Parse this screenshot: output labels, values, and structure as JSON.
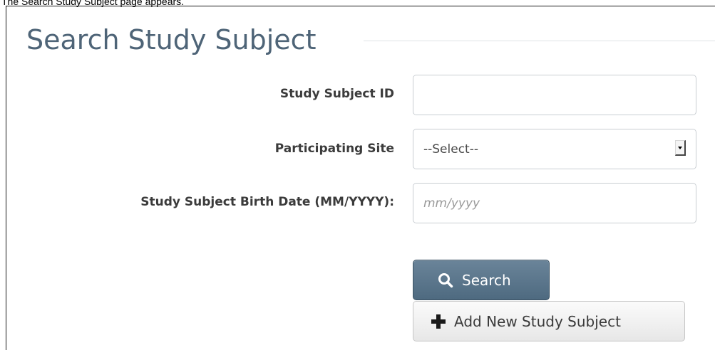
{
  "caption": "The Search Study Subject page appears.",
  "page": {
    "title": "Search Study Subject"
  },
  "form": {
    "study_subject_id": {
      "label": "Study Subject ID",
      "value": ""
    },
    "participating_site": {
      "label": "Participating Site",
      "selected": "--Select--"
    },
    "birth_date": {
      "label": "Study Subject Birth Date (MM/YYYY):",
      "placeholder": "mm/yyyy",
      "value": ""
    }
  },
  "buttons": {
    "search": {
      "label": "Search",
      "icon": "search-icon"
    },
    "add_new": {
      "label": "Add New Study Subject",
      "icon": "plus-icon"
    }
  },
  "colors": {
    "title": "#4e6477",
    "search_button": "#5b758a"
  }
}
